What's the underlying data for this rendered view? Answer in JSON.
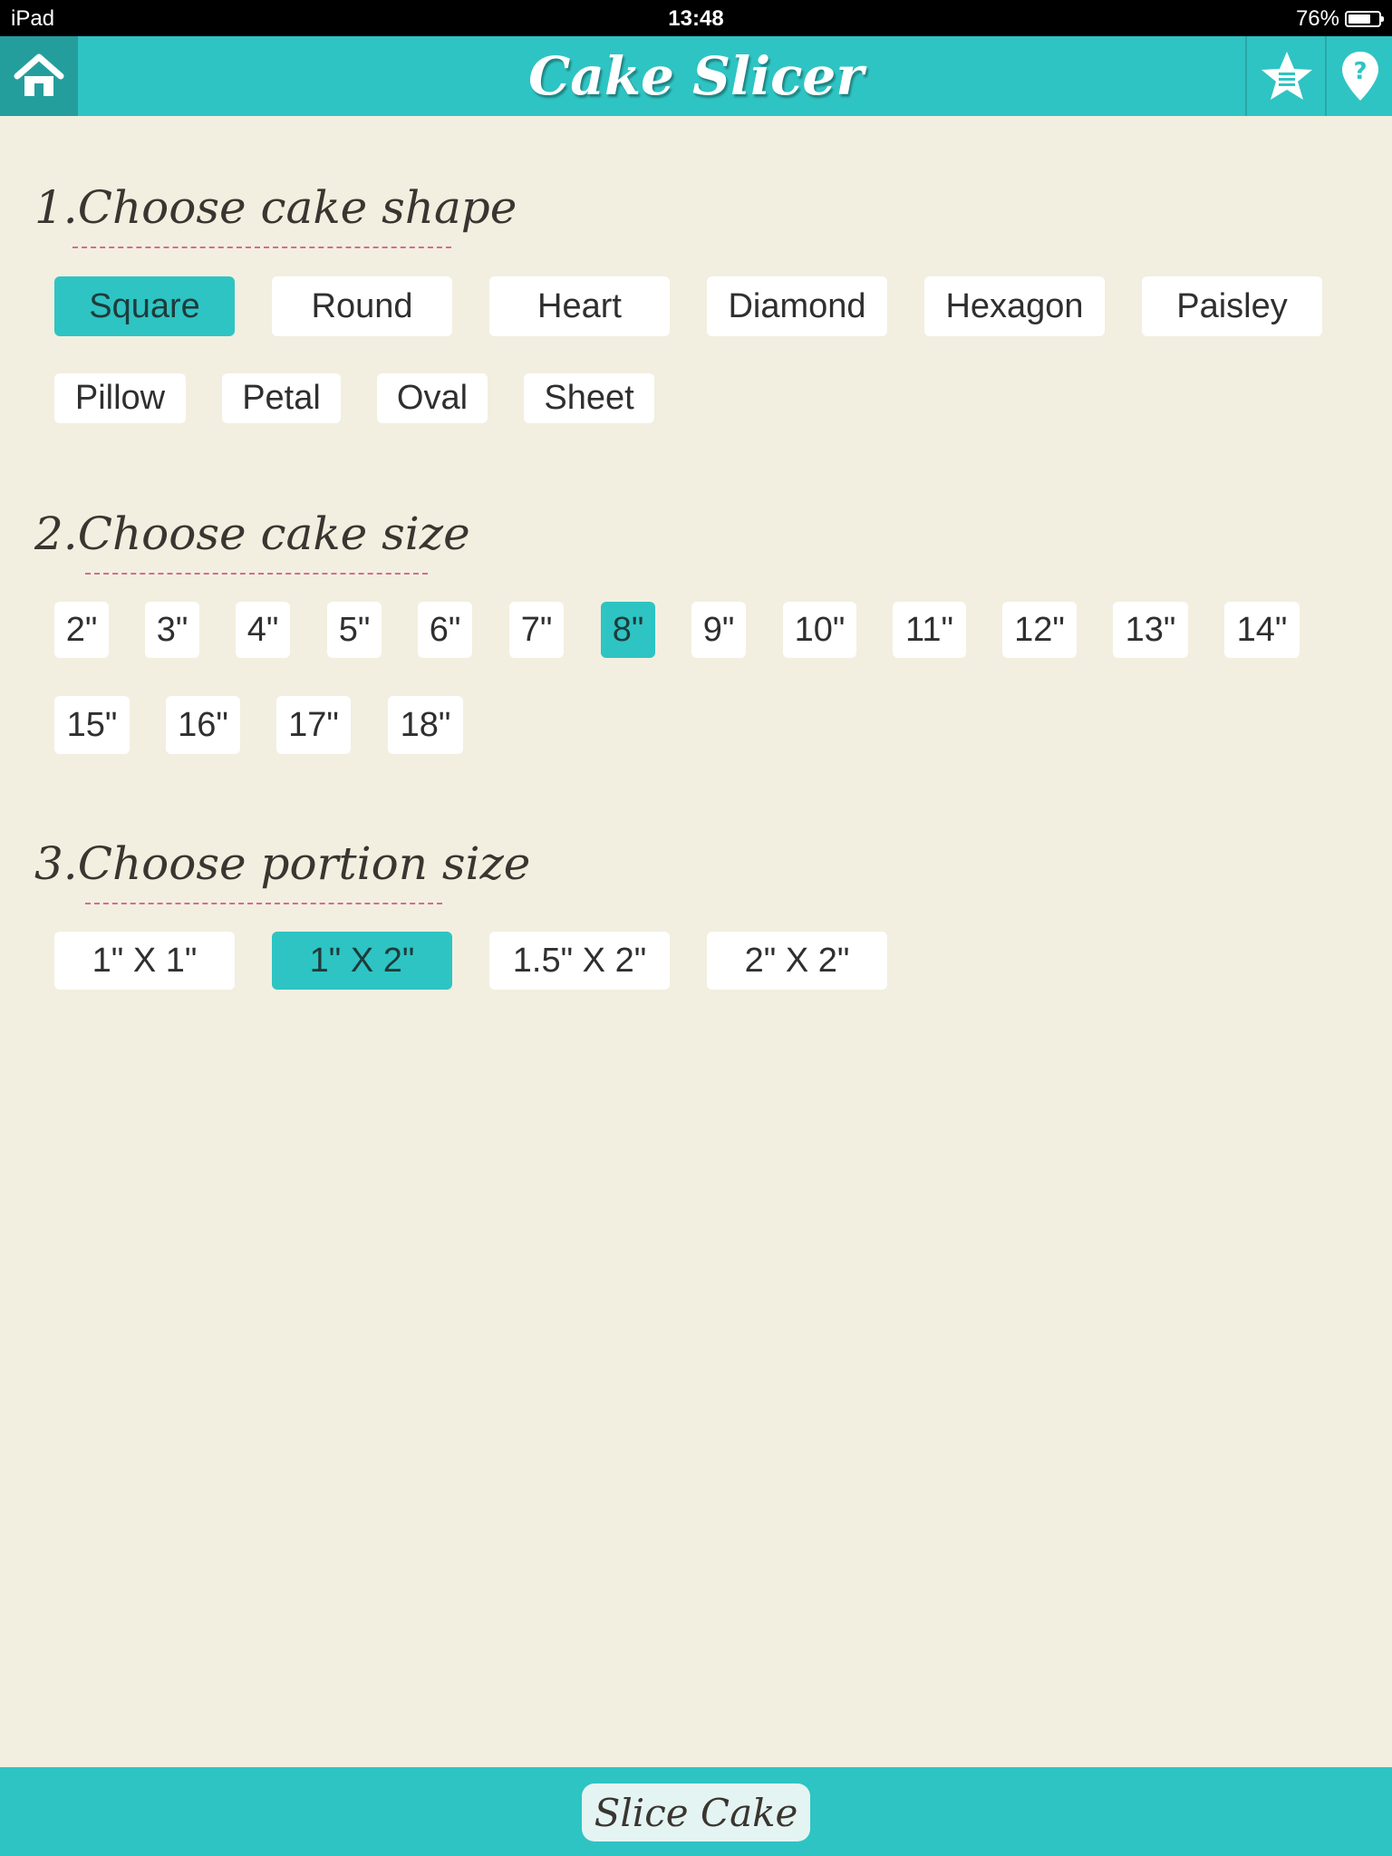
{
  "status_bar": {
    "device": "iPad",
    "time": "13:48",
    "battery_text": "76%",
    "battery_level": 0.76
  },
  "header": {
    "title": "Cake Slicer",
    "home_icon": "home-icon",
    "favorites_icon": "star-list-icon",
    "help_icon": "help-pin-icon"
  },
  "colors": {
    "accent": "#2ec4c3",
    "background": "#f2efe0",
    "underline": "#d26d8e"
  },
  "sections": {
    "shape": {
      "number": "1.",
      "title": "Choose cake shape",
      "options": [
        "Square",
        "Round",
        "Heart",
        "Diamond",
        "Hexagon",
        "Paisley",
        "Pillow",
        "Petal",
        "Oval",
        "Sheet"
      ],
      "selected": "Square"
    },
    "size": {
      "number": "2.",
      "title": "Choose cake size",
      "options": [
        "2\"",
        "3\"",
        "4\"",
        "5\"",
        "6\"",
        "7\"",
        "8\"",
        "9\"",
        "10\"",
        "11\"",
        "12\"",
        "13\"",
        "14\"",
        "15\"",
        "16\"",
        "17\"",
        "18\""
      ],
      "selected": "8\""
    },
    "portion": {
      "number": "3.",
      "title": "Choose portion size",
      "options": [
        "1\" X 1\"",
        "1\" X 2\"",
        "1.5\" X 2\"",
        "2\" X 2\""
      ],
      "selected": "1\" X 2\""
    }
  },
  "footer": {
    "slice_label": "Slice Cake"
  }
}
